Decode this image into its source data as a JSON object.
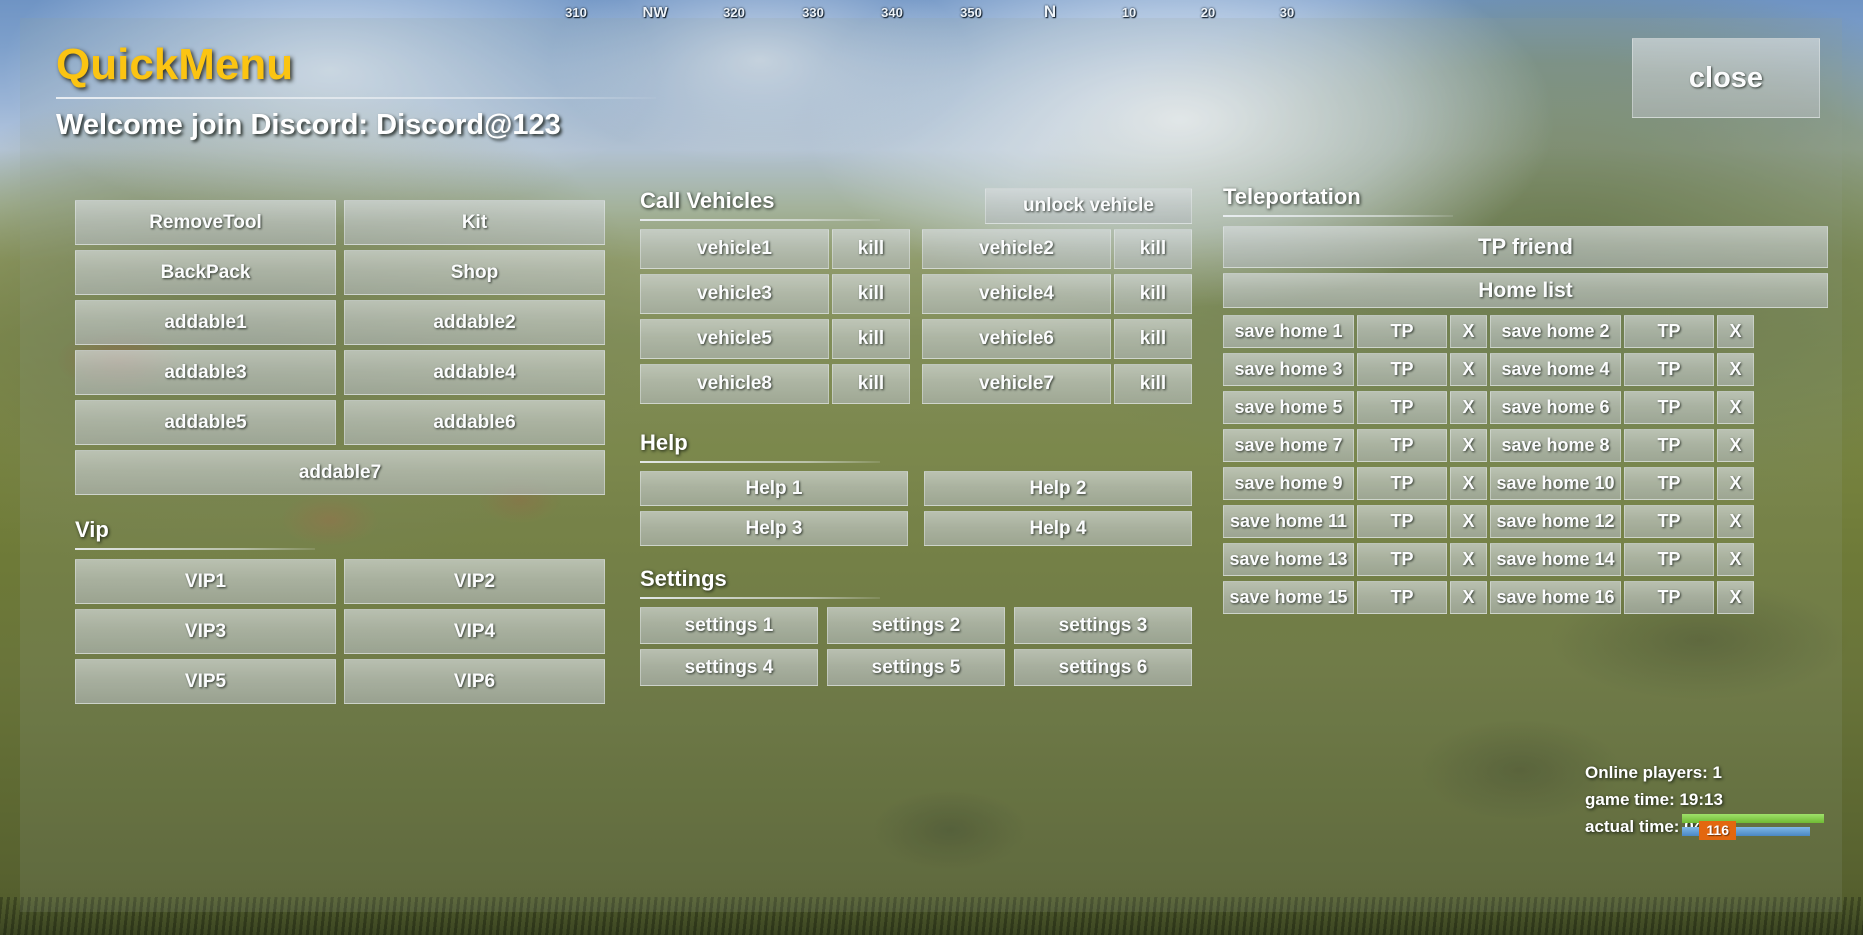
{
  "compass": {
    "ticks": [
      "310",
      "NW",
      "320",
      "330",
      "340",
      "350",
      "N",
      "10",
      "20",
      "30"
    ]
  },
  "header": {
    "title": "QuickMenu",
    "welcome": "Welcome join Discord: Discord@123",
    "close_label": "close"
  },
  "left": {
    "buttons": [
      "RemoveTool",
      "Kit",
      "BackPack",
      "Shop",
      "addable1",
      "addable2",
      "addable3",
      "addable4",
      "addable5",
      "addable6"
    ],
    "full_button": "addable7",
    "vip_heading": "Vip",
    "vip_buttons": [
      "VIP1",
      "VIP2",
      "VIP3",
      "VIP4",
      "VIP5",
      "VIP6"
    ]
  },
  "vehicles": {
    "heading": "Call Vehicles",
    "unlock_label": "unlock vehicle",
    "kill_label": "kill",
    "left_column": [
      "vehicle1",
      "vehicle3",
      "vehicle5",
      "vehicle8"
    ],
    "right_column": [
      "vehicle2",
      "vehicle4",
      "vehicle6",
      "vehicle7"
    ]
  },
  "help": {
    "heading": "Help",
    "buttons": [
      "Help 1",
      "Help 2",
      "Help 3",
      "Help 4"
    ]
  },
  "settings": {
    "heading": "Settings",
    "buttons": [
      "settings 1",
      "settings 2",
      "settings 3",
      "settings 4",
      "settings 5",
      "settings 6"
    ]
  },
  "teleportation": {
    "heading": "Teleportation",
    "tp_friend_label": "TP friend",
    "home_list_label": "Home list",
    "tp_label": "TP",
    "delete_label": "X",
    "homes": [
      "save home 1",
      "save home 2",
      "save home 3",
      "save home 4",
      "save home 5",
      "save home 6",
      "save home 7",
      "save home 8",
      "save home 9",
      "save home 10",
      "save home 11",
      "save home 12",
      "save home 13",
      "save home 14",
      "save home 15",
      "save home 16"
    ]
  },
  "stats": {
    "online_players": "Online players: 1",
    "game_time": "game time: 19:13",
    "actual_time": "actual time: 04:41"
  },
  "hud": {
    "badge": "116"
  },
  "colors": {
    "title_accent": "#fbc412",
    "text": "#ffffff",
    "button_face": "#c4cacb",
    "badge": "#e3670f"
  }
}
